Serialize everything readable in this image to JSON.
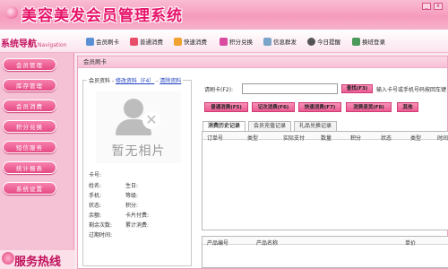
{
  "app": {
    "title": "美容美发会员管理系统",
    "controls": [
      "_",
      "x"
    ]
  },
  "sidebar": {
    "title": "系统导航",
    "title_sub": "Navigation",
    "items": [
      {
        "label": "会员管理"
      },
      {
        "label": "库存管理"
      },
      {
        "label": "会员消费"
      },
      {
        "label": "积分兑换"
      },
      {
        "label": "短信服务"
      },
      {
        "label": "统计报表"
      },
      {
        "label": "系统设置"
      }
    ],
    "hotline": "服务热线"
  },
  "toolbar": {
    "items": [
      {
        "label": "会员刷卡",
        "icon": "card-icon"
      },
      {
        "label": "普通消费",
        "icon": "cart-icon"
      },
      {
        "label": "快速消费",
        "icon": "lightning-icon"
      },
      {
        "label": "积分兑换",
        "icon": "gift-icon"
      },
      {
        "label": "信息群发",
        "icon": "mail-icon"
      },
      {
        "label": "今日提醒",
        "icon": "clock-icon"
      },
      {
        "label": "换班登录",
        "icon": "switch-user-icon"
      }
    ]
  },
  "main": {
    "title": "会员刷卡",
    "member": {
      "section_label": "会员资料",
      "edit_link": "修改资料（F4）",
      "clear_link": "清除资料",
      "photo_caption": "暂无相片",
      "fields_left": [
        "卡号:",
        "姓名:",
        "手机:",
        "状态:",
        "余额:",
        "剩余次数:",
        "过期时间:"
      ],
      "fields_right": [
        "生日:",
        "等级:",
        "积分:",
        "卡片付费:",
        "累计消费:"
      ]
    },
    "search": {
      "label": "请刷卡(F2):",
      "value": "",
      "button": "查找(F3)",
      "hint": "输入卡号或手机号码按回车键"
    },
    "actions": [
      {
        "label": "普通消费(F5)"
      },
      {
        "label": "记次消费(F6)"
      },
      {
        "label": "快速消费(F7)"
      },
      {
        "label": "消费退货(F8)"
      },
      {
        "label": "其他"
      }
    ],
    "tabs": [
      {
        "label": "消费历史记录",
        "active": true
      },
      {
        "label": "会员充值记录",
        "active": false
      },
      {
        "label": "礼品兑换记录",
        "active": false
      }
    ],
    "history_columns": [
      "订单号",
      "类型",
      "实际支付",
      "数量",
      "积分",
      "状态",
      "类型",
      "时间"
    ],
    "product_columns": [
      "产品编号",
      "产品名称",
      "单价"
    ]
  },
  "colors": {
    "accent": "#e6146a",
    "button": "#e95c92",
    "sidebar": "#f5c2d5"
  }
}
